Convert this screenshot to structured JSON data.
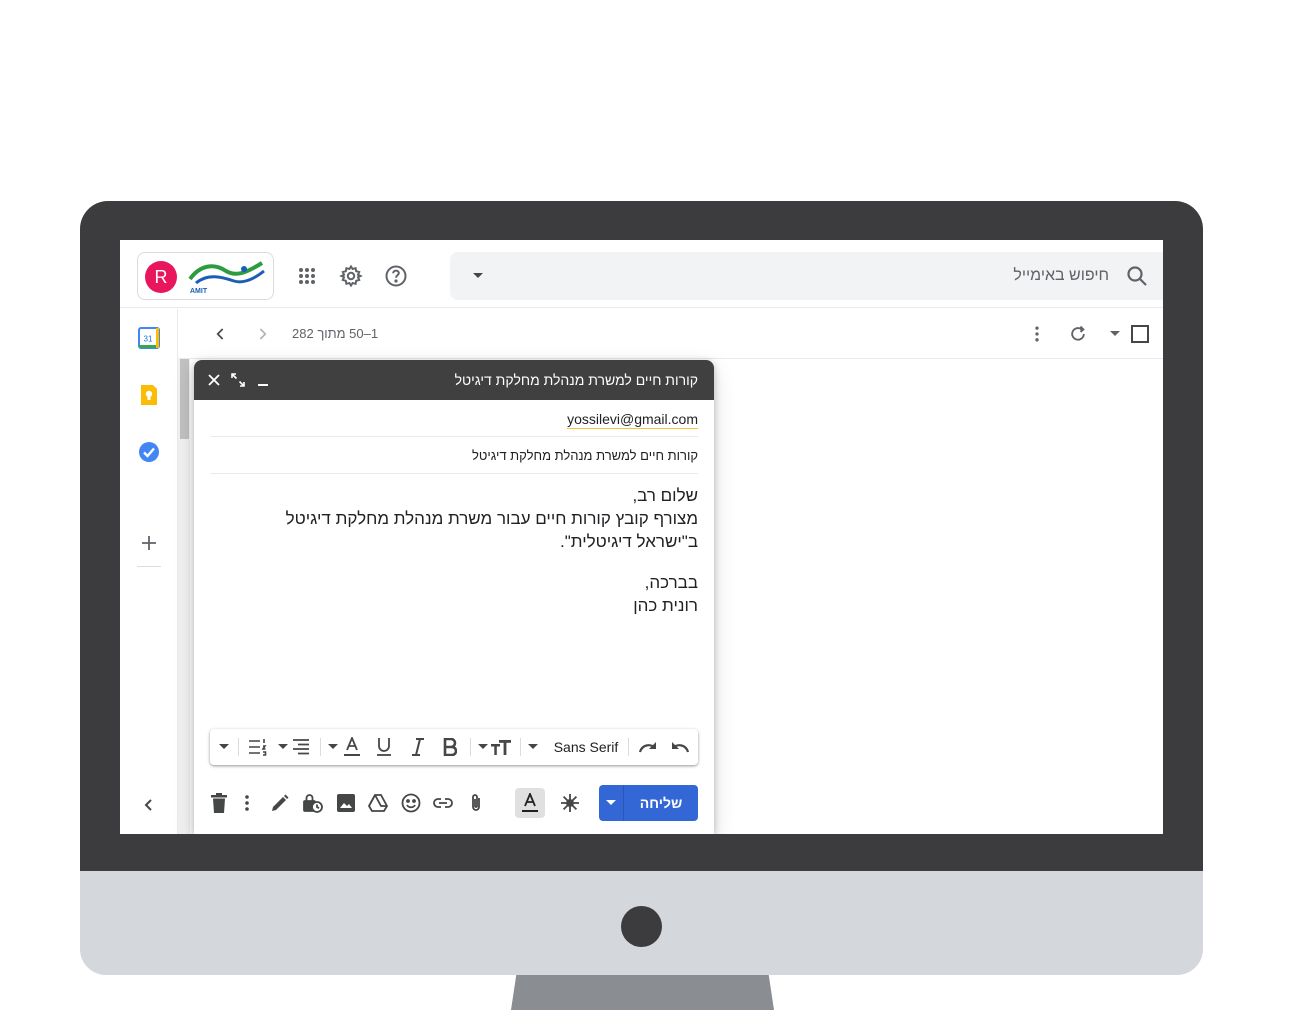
{
  "search": {
    "placeholder": "חיפוש באימייל"
  },
  "account": {
    "avatar_initial": "R",
    "avatar_color": "#e8175d",
    "logo_text": "AMIT"
  },
  "colors": {
    "compose_header": "#404040",
    "send_button": "#3367d6",
    "accent_blue": "#1a73e8"
  },
  "list_toolbar": {
    "pagination": "1–50 מתוך 282"
  },
  "side_rail": {
    "calendar_day": "31"
  },
  "compose": {
    "title": "קורות חיים למשרת מנהלת מחלקת דיגיטל",
    "recipient": "yossilevi@gmail.com",
    "subject": "קורות חיים למשרת מנהלת מחלקת דיגיטל",
    "body": {
      "line1": "שלום רב,",
      "line2": "מצורף קובץ קורות חיים עבור משרת מנהלת מחלקת דיגיטל",
      "line3": "ב\"ישראל דיגיטלית\".",
      "line4": "בברכה,",
      "line5": "רונית כהן"
    },
    "font_name": "Sans Serif",
    "send_label": "שליחה"
  },
  "icons": {
    "top_bar": [
      "search-icon",
      "search-options-icon",
      "help-icon",
      "settings-icon",
      "apps-icon"
    ],
    "list_toolbar": [
      "checkbox-icon",
      "select-dropdown-icon",
      "refresh-icon",
      "more-vert-icon",
      "next-page-icon",
      "prev-page-icon"
    ],
    "side_rail": [
      "calendar-icon",
      "keep-icon",
      "tasks-icon",
      "add-icon",
      "collapse-icon"
    ],
    "compose_header": [
      "close-icon",
      "fullscreen-icon",
      "minimize-icon"
    ],
    "format_bar": [
      "undo-icon",
      "redo-icon",
      "font-dropdown-icon",
      "text-size-icon",
      "bold-icon",
      "italic-icon",
      "underline-icon",
      "text-color-icon",
      "align-icon",
      "numbered-list-icon",
      "more-formatting-icon"
    ],
    "bottom_bar": [
      "send-options-icon",
      "ai-sparkle-icon",
      "formatting-toggle-icon",
      "attach-icon",
      "link-icon",
      "emoji-icon",
      "drive-icon",
      "photo-icon",
      "lock-clock-icon",
      "signature-icon",
      "more-options-icon",
      "trash-icon"
    ]
  }
}
